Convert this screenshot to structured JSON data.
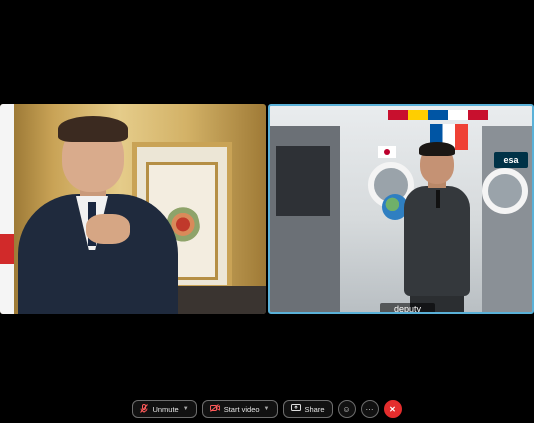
{
  "participants": [
    {
      "id": "left",
      "name": ""
    },
    {
      "id": "right",
      "name": "deputy"
    }
  ],
  "scene": {
    "esa_badge": "esa"
  },
  "toolbar": {
    "unmute_label": "Unmute",
    "start_video_label": "Start video",
    "share_label": "Share",
    "icons": {
      "mic": "mic-off-icon",
      "video": "video-camera-icon",
      "share": "screen-share-icon",
      "reactions": "emoji-icon",
      "more": "more-options-icon",
      "end": "end-call-icon",
      "chevron": "chevron-down-icon"
    }
  },
  "colors": {
    "active_speaker_border": "#5ab1d8",
    "end_call": "#e42d2d"
  }
}
